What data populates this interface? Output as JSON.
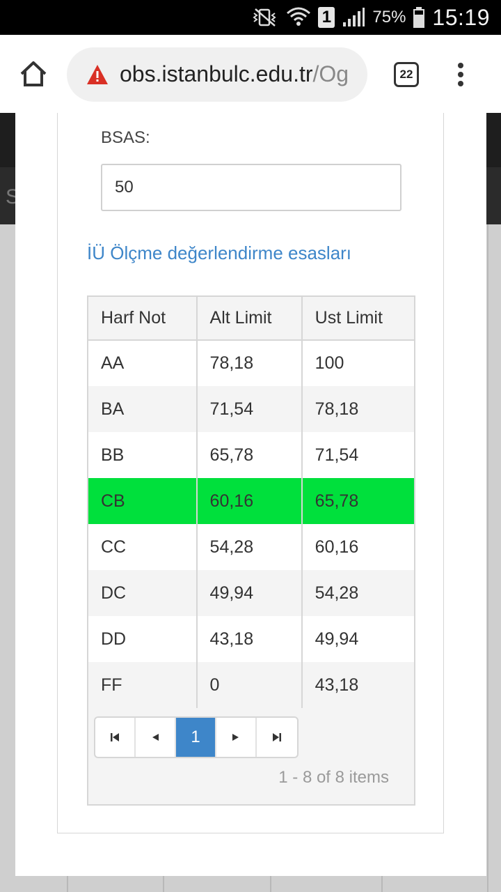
{
  "status_bar": {
    "battery_percent": "75%",
    "time": "15:19",
    "sim_slot": "1",
    "icons": [
      "mute-vibrate-icon",
      "wifi-icon",
      "sim-icon",
      "signal-icon",
      "battery-icon"
    ]
  },
  "browser": {
    "url_host": "obs.istanbulc.edu.tr",
    "url_path": "/Og",
    "tab_count": "22",
    "icons": [
      "home-icon",
      "warning-icon",
      "tabs-icon",
      "menu-icon"
    ]
  },
  "form": {
    "bsas_label": "BSAS:",
    "bsas_value": "50",
    "esaslar_link": "İÜ Ölçme değerlendirme esasları"
  },
  "grade_table": {
    "columns": [
      "Harf Not",
      "Alt Limit",
      "Ust Limit"
    ],
    "rows": [
      [
        "AA",
        "78,18",
        "100"
      ],
      [
        "BA",
        "71,54",
        "78,18"
      ],
      [
        "BB",
        "65,78",
        "71,54"
      ],
      [
        "CB",
        "60,16",
        "65,78"
      ],
      [
        "CC",
        "54,28",
        "60,16"
      ],
      [
        "DC",
        "49,94",
        "54,28"
      ],
      [
        "DD",
        "43,18",
        "49,94"
      ],
      [
        "FF",
        "0",
        "43,18"
      ]
    ],
    "highlighted_row": "CB",
    "highlight_color": "#00e03c"
  },
  "pagination": {
    "current_page": "1",
    "info": "1 - 8 of 8 items",
    "icons": [
      "first-page-icon",
      "prev-page-icon",
      "next-page-icon",
      "last-page-icon"
    ]
  },
  "colors": {
    "accent": "#3e86c9",
    "highlight": "#00e03c",
    "warning": "#d93025"
  }
}
